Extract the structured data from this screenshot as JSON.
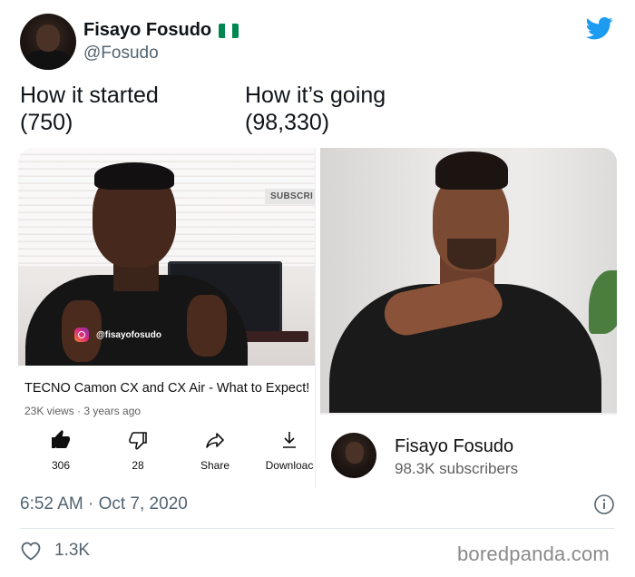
{
  "author": {
    "display_name": "Fisayo Fosudo",
    "handle": "@Fosudo",
    "flag_colors": [
      "#008751",
      "#ffffff",
      "#008751"
    ]
  },
  "brand": {
    "icon": "twitter-bird-icon",
    "color": "#1d9bf0"
  },
  "tweet": {
    "left_line1": "How it started",
    "left_line2": "(750)",
    "right_line1": "How it’s going",
    "right_line2": "(98,330)"
  },
  "left_video": {
    "subscribe_tag": "SUBSCRI",
    "instagram_tag": "@fisayofosudo",
    "title": "TECNO Camon CX and CX Air - What to Expect!",
    "meta": "23K views · 3 years ago",
    "actions": [
      {
        "icon": "thumbs-up-icon",
        "label": "306"
      },
      {
        "icon": "thumbs-down-icon",
        "label": "28"
      },
      {
        "icon": "share-icon",
        "label": "Share"
      },
      {
        "icon": "download-icon",
        "label": "Downloac"
      }
    ]
  },
  "right_video": {
    "channel_name": "Fisayo Fosudo",
    "subscribers": "98.3K subscribers"
  },
  "footer": {
    "timestamp": "6:52 AM · Oct 7, 2020",
    "likes": "1.3K",
    "watermark": "boredpanda.com"
  }
}
